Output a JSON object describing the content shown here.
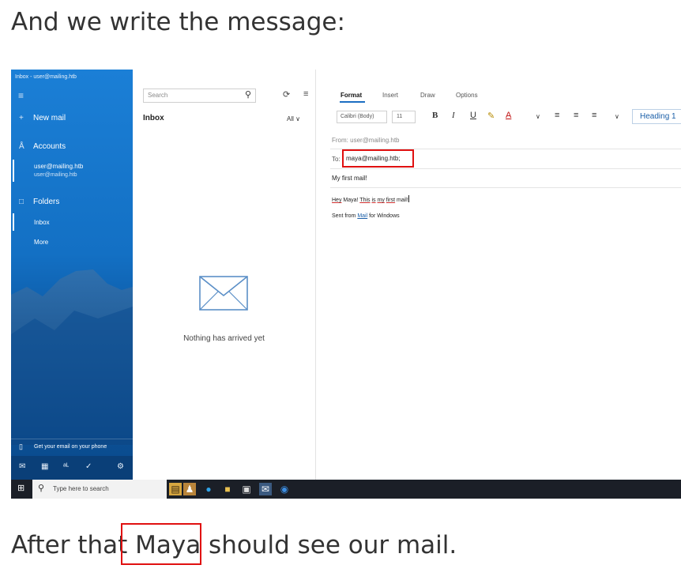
{
  "article": {
    "intro": "And we write the message:",
    "outro": "After that Maya should see our mail."
  },
  "colors": {
    "accent": "#1b6ec2",
    "highlight_box": "#e01010",
    "sidebar_blue": "#1370c4",
    "taskbar": "#1b1f27"
  },
  "sidebar": {
    "window_title": "Inbox - user@mailing.htb",
    "menu_icon": "hamburger-icon",
    "new_mail": "New mail",
    "accounts": "Accounts",
    "account_name": "user@mailing.htb",
    "account_email": "user@mailing.htb",
    "folders": "Folders",
    "inbox": "Inbox",
    "more": "More",
    "phone_promo": "Get your email on your phone"
  },
  "list": {
    "search_placeholder": "Search",
    "header": "Inbox",
    "filter": "All",
    "empty": "Nothing has arrived yet"
  },
  "compose": {
    "tabs": [
      "Format",
      "Insert",
      "Draw",
      "Options"
    ],
    "font": "Calibri (Body)",
    "font_size": "11",
    "bold": "B",
    "italic": "I",
    "underline": "U",
    "style": "Heading 1",
    "from_label": "From:",
    "from_value": "user@mailing.htb",
    "to_label": "To:",
    "to_value": "maya@mailing.htb;",
    "subject": "My first mail!",
    "body_words": [
      "Hey",
      "Maya!",
      "This",
      "is",
      "my",
      "first",
      "mail!"
    ],
    "signature_prefix": "Sent from",
    "signature_link": "Mail",
    "signature_suffix": "for Windows"
  },
  "taskbar": {
    "search_placeholder": "Type here to search"
  }
}
